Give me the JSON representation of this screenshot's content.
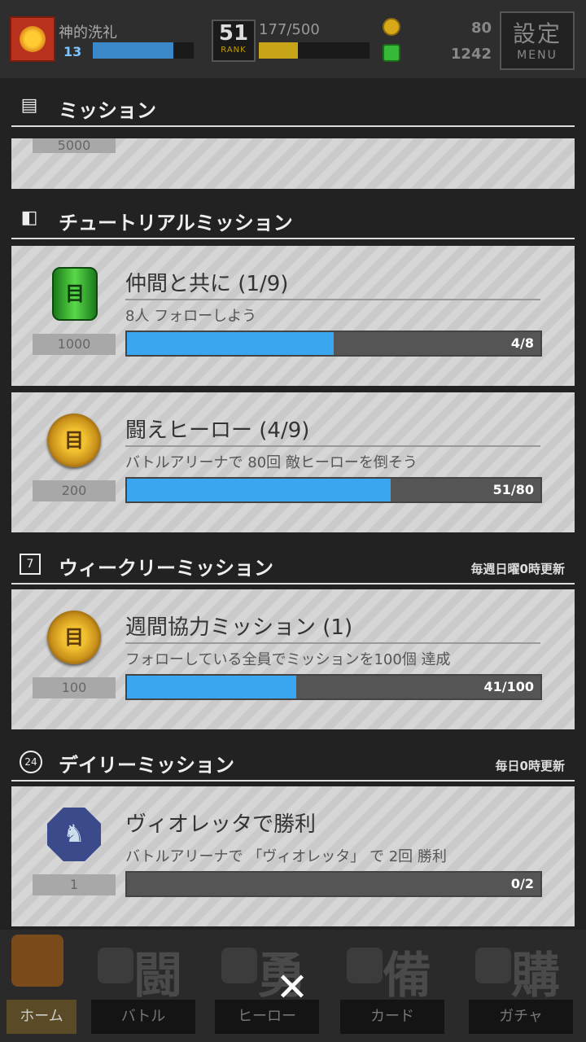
{
  "topbar": {
    "player_name": "神的洗礼",
    "player_level": "13",
    "exp_fraction": 0.8,
    "rank_number": "51",
    "rank_label": "RANK",
    "rank_progress": "177/500",
    "rank_fraction": 0.354,
    "coins": "80",
    "gems": "1242",
    "menu_kanji": "設定",
    "menu_label": "MENU"
  },
  "mission_header": {
    "title": "ミッション"
  },
  "partial_card": {
    "reward_amount": "5000"
  },
  "sections": {
    "tutorial": {
      "title": "チュートリアルミッション",
      "missions": [
        {
          "title": "仲間と共に (1/9)",
          "desc": "8人 フォローしよう",
          "reward_amount": "1000",
          "reward_icon": "green-barrel-icon",
          "progress_text": "4/8",
          "progress_fraction": 0.5
        },
        {
          "title": "闘えヒーロー (4/9)",
          "desc": "バトルアリーナで 80回 敵ヒーローを倒そう",
          "reward_amount": "200",
          "reward_icon": "gold-coin-icon",
          "progress_text": "51/80",
          "progress_fraction": 0.6375
        }
      ]
    },
    "weekly": {
      "title": "ウィークリーミッション",
      "icon_text": "7",
      "note": "毎週日曜0時更新",
      "missions": [
        {
          "title": "週間協力ミッション (1)",
          "desc": "フォローしている全員でミッションを100個 達成",
          "reward_amount": "100",
          "reward_icon": "gold-coin-icon",
          "progress_text": "41/100",
          "progress_fraction": 0.41
        }
      ]
    },
    "daily": {
      "title": "デイリーミッション",
      "icon_text": "24",
      "note": "毎日0時更新",
      "missions": [
        {
          "title": "ヴィオレッタで勝利",
          "desc": "バトルアリーナで 「ヴィオレッタ」 で 2回 勝利",
          "reward_amount": "1",
          "reward_icon": "hero-medal-icon",
          "progress_text": "0/2",
          "progress_fraction": 0
        }
      ]
    }
  },
  "bottom_nav": {
    "tabs": [
      {
        "label": "ホーム",
        "kanji": ""
      },
      {
        "label": "バトル",
        "kanji": "闘"
      },
      {
        "label": "ヒーロー",
        "kanji": "勇"
      },
      {
        "label": "カード",
        "kanji": "備"
      },
      {
        "label": "ガチャ",
        "kanji": "購"
      }
    ]
  },
  "close_symbol": "✕",
  "coin_glyph": "目"
}
